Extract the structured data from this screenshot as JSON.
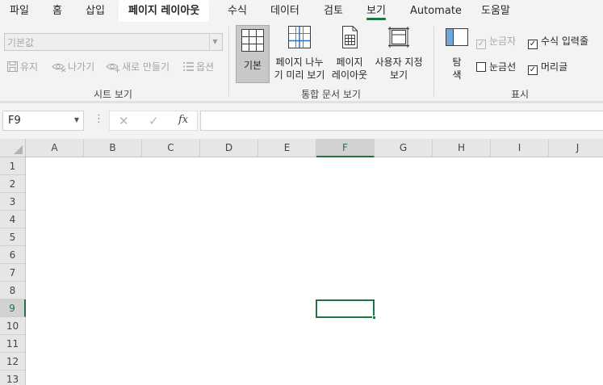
{
  "tabs": [
    {
      "label": "파일",
      "active": false
    },
    {
      "label": "홈",
      "active": false
    },
    {
      "label": "삽입",
      "active": false
    },
    {
      "label": "페이지 레이아웃",
      "active": false
    },
    {
      "label": "수식",
      "active": false
    },
    {
      "label": "데이터",
      "active": false
    },
    {
      "label": "검토",
      "active": false
    },
    {
      "label": "보기",
      "active": true
    },
    {
      "label": "Automate",
      "active": false
    },
    {
      "label": "도움말",
      "active": false
    }
  ],
  "ribbon": {
    "sheet_view": {
      "dropdown_value": "기본값",
      "keep_label": "유지",
      "exit_label": "나가기",
      "new_label": "새로 만들기",
      "options_label": "옵션",
      "group_label": "시트 보기"
    },
    "workbook_views": {
      "normal_label": "기본",
      "page_break_line1": "페이지 나누",
      "page_break_line2": "기 미리 보기",
      "page_layout_line1": "페이지",
      "page_layout_line2": "레이아웃",
      "custom_line1": "사용자 지정",
      "custom_line2": "보기",
      "group_label": "통합 문서 보기"
    },
    "show": {
      "navigation_line1": "탐",
      "navigation_line2": "색",
      "ruler_label": "눈금자",
      "ruler_checked": true,
      "ruler_enabled": false,
      "formula_bar_label": "수식 입력줄",
      "formula_bar_checked": true,
      "gridlines_label": "눈금선",
      "gridlines_checked": false,
      "headings_label": "머리글",
      "headings_checked": true,
      "group_label": "표시"
    }
  },
  "formula_bar": {
    "name_box": "F9",
    "cancel_glyph": "✕",
    "enter_glyph": "✓",
    "fx_label": "fx",
    "formula_value": ""
  },
  "grid": {
    "columns": [
      "A",
      "B",
      "C",
      "D",
      "E",
      "F",
      "G",
      "H",
      "I",
      "J"
    ],
    "rows": [
      "1",
      "2",
      "3",
      "4",
      "5",
      "6",
      "7",
      "8",
      "9",
      "10",
      "11",
      "12",
      "13"
    ],
    "selected_column": "F",
    "selected_row": "9"
  },
  "colors": {
    "accent": "#217346",
    "ribbon_bg": "#f3f3f3",
    "header_bg": "#e6e6e6"
  }
}
